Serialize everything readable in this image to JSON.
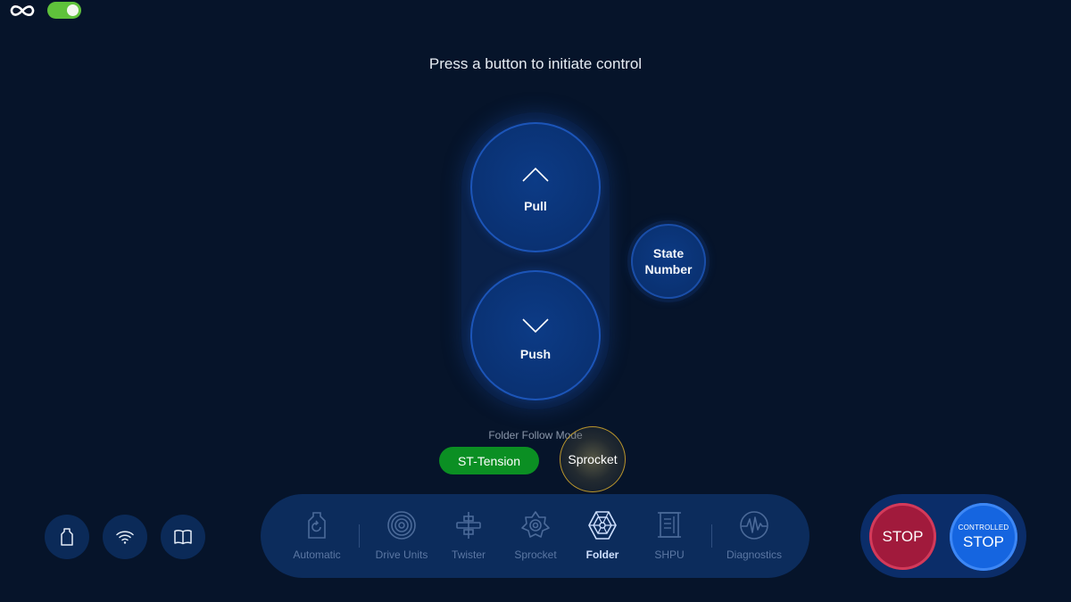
{
  "header": {
    "toggle_on": true,
    "toggle_color": "#5fc23b"
  },
  "prompt": "Press a button to initiate control",
  "jog": {
    "pull_label": "Pull",
    "push_label": "Push",
    "state_label_line1": "State",
    "state_label_line2": "Number"
  },
  "follow_mode": {
    "label": "Folder Follow Mode",
    "options": [
      "ST-Tension",
      "Sprocket"
    ],
    "active_option": "ST-Tension",
    "active_color": "#0b8f23"
  },
  "utility_icons": [
    "bag-icon",
    "wifi-icon",
    "book-icon"
  ],
  "nav": {
    "items": [
      {
        "label": "Automatic",
        "icon": "automatic-icon"
      },
      {
        "label": "Drive Units",
        "icon": "drive-units-icon"
      },
      {
        "label": "Twister",
        "icon": "twister-icon"
      },
      {
        "label": "Sprocket",
        "icon": "sprocket-icon"
      },
      {
        "label": "Folder",
        "icon": "folder-icon"
      },
      {
        "label": "SHPU",
        "icon": "shpu-icon"
      },
      {
        "label": "Diagnostics",
        "icon": "diagnostics-icon"
      }
    ],
    "active": "Folder"
  },
  "stop": {
    "stop_label": "STOP",
    "controlled_small": "CONTROLLED",
    "controlled_big": "STOP",
    "stop_color": "#a11a3c",
    "controlled_color": "#1565e0"
  }
}
